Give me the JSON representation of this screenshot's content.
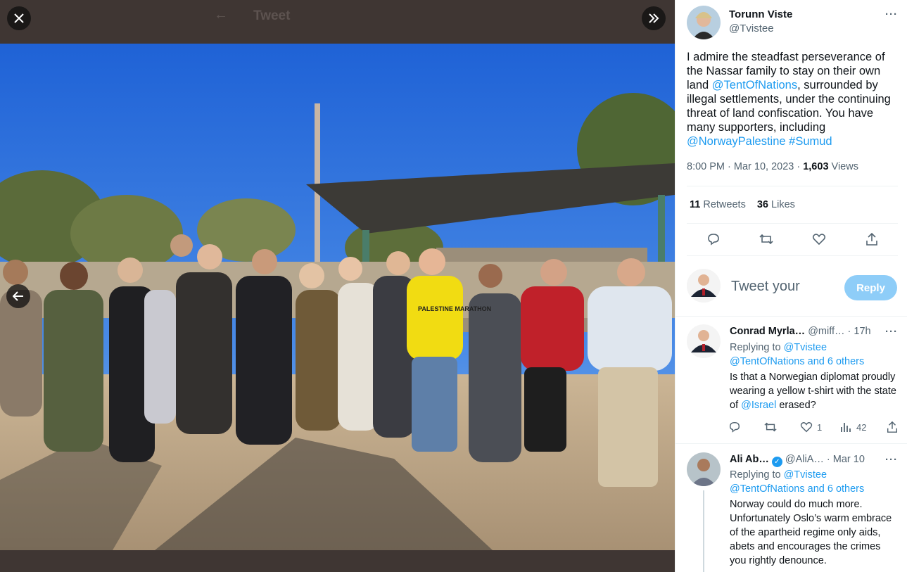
{
  "viewer": {
    "ghost_back": "←",
    "ghost_title": "Tweet",
    "close_icon": "×",
    "expand_icon": "»",
    "prev_icon": "←"
  },
  "photo": {
    "shirt_text": "PALESTINE MARATHON"
  },
  "tweet": {
    "author_name": "Torunn Viste",
    "author_handle": "@Tvistee",
    "text_1": "I admire the steadfast perseverance of the Nassar family to stay on their own land ",
    "mention_1": "@TentOfNations",
    "text_2": ", surrounded by illegal settlements, under the continuing threat of land confiscation. You have many supporters, including ",
    "mention_2": "@NorwayPalestine",
    "text_3": " ",
    "hashtag": "#Sumud",
    "time": "8:00 PM · Mar 10, 2023 · ",
    "views_count": "1,603",
    "views_label": " Views",
    "retweets_count": "11",
    "retweets_label": " Retweets",
    "likes_count": "36",
    "likes_label": " Likes"
  },
  "reply_box": {
    "placeholder": "Tweet your",
    "button": "Reply"
  },
  "comments": [
    {
      "name": "Conrad Myrla…",
      "handle": " @miff…",
      "time": " · 17h",
      "replying_prefix": "Replying to ",
      "replying_to": "@Tvistee",
      "replying_others": "@TentOfNations and 6 others",
      "body_1": "Is that a Norwegian diplomat proudly wearing a yellow t-shirt with the state of ",
      "body_mention": "@Israel",
      "body_2": " erased?",
      "likes": "1",
      "views": "42"
    },
    {
      "name": "Ali Ab…",
      "handle": " @AliA…",
      "time": " · Mar 10",
      "replying_prefix": "Replying to ",
      "replying_to": "@Tvistee",
      "replying_others": "@TentOfNations and 6 others",
      "body": "Norway could do much more. Unfortunately Oslo’s warm embrace of the apartheid regime only aids, abets and encourages the crimes you rightly denounce."
    }
  ],
  "icons": {
    "more": "···",
    "reply": "reply-icon",
    "retweet": "retweet-icon",
    "like": "heart-icon",
    "share": "share-icon",
    "views": "views-icon",
    "verified": "✓"
  },
  "colors": {
    "accent": "#1d9bf0",
    "reply_button": "#8ecdf8",
    "viewer_bg": "#3f3633"
  }
}
